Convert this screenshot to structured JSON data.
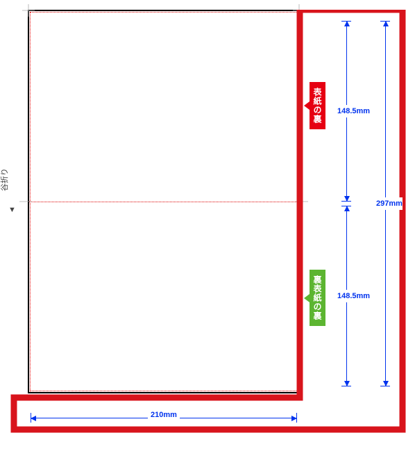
{
  "fold": {
    "label": "谷折り",
    "arrow": "▼"
  },
  "page_panel": {
    "top_label": "表紙の裏",
    "bottom_label": "裏表紙の裏"
  },
  "dimensions": {
    "width": "210mm",
    "half_height_top": "148.5mm",
    "half_height_bottom": "148.5mm",
    "full_height": "297mm"
  },
  "colors": {
    "dim": "#0033ee",
    "tag_red": "#e60012",
    "tag_green": "#5cb531",
    "highlight": "#d8141c"
  }
}
